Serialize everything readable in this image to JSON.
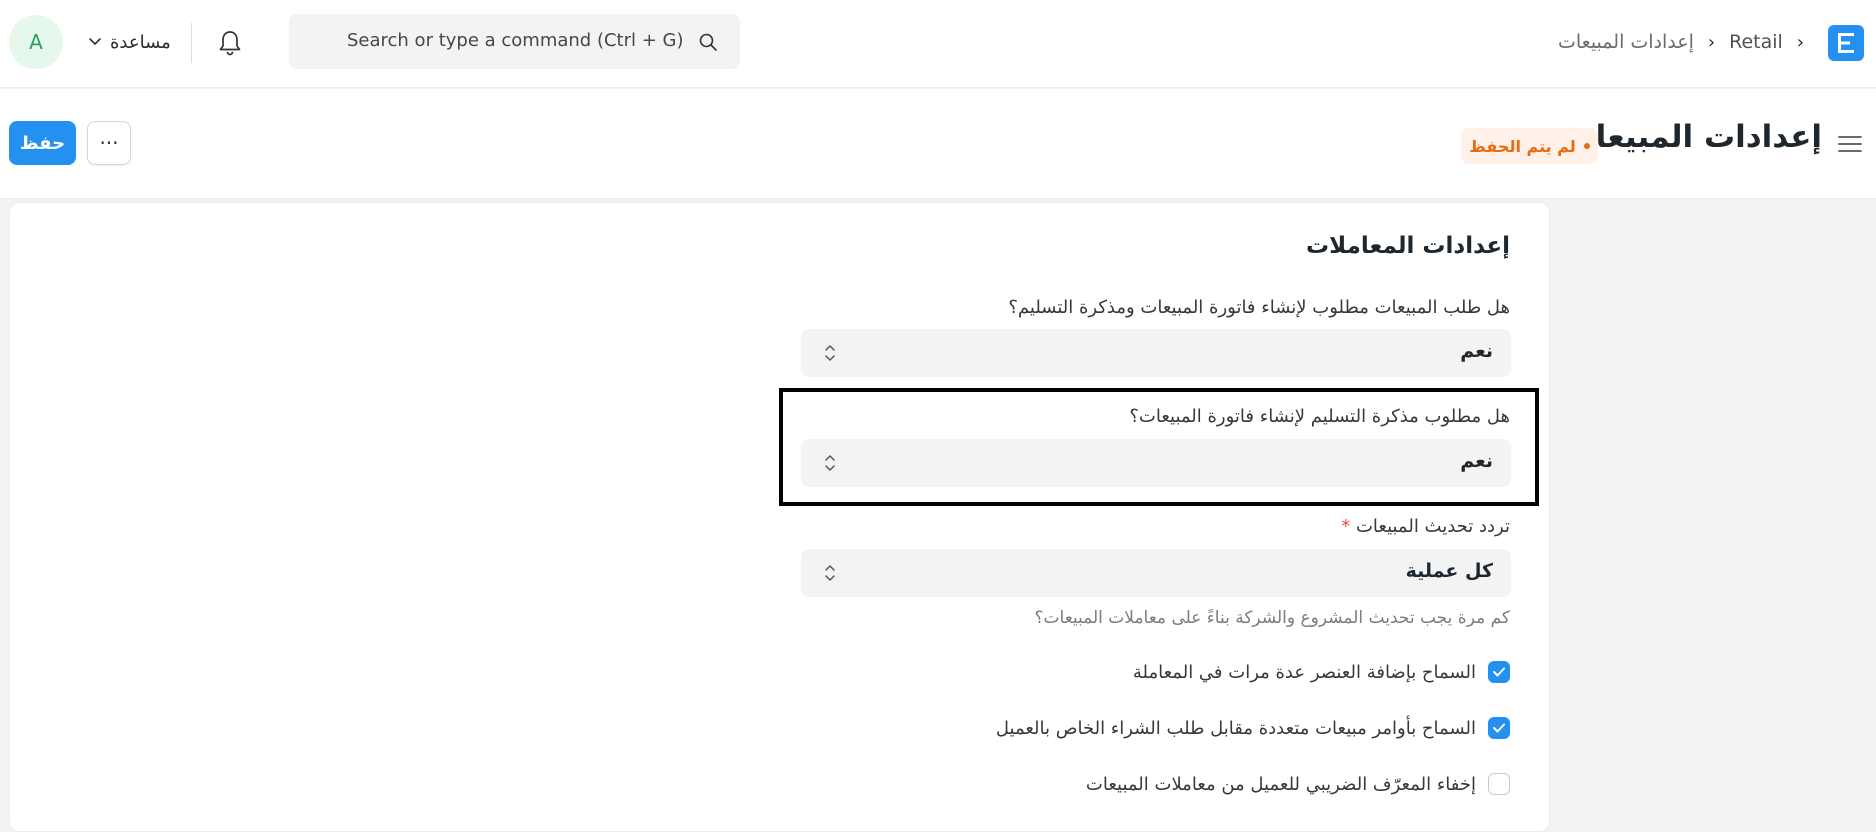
{
  "navbar": {
    "logo_letter": "E",
    "breadcrumbs": [
      "Retail",
      "إعدادات المبيعات"
    ],
    "search_placeholder": "Search or type a command (Ctrl + G)",
    "help_label": "مساعدة",
    "avatar_letter": "A"
  },
  "page": {
    "title": "إعدادات المبيعات",
    "status_badge": "لم يتم الحفظ",
    "more_label": "···",
    "save_label": "حفظ"
  },
  "section": {
    "title": "إعدادات المعاملات",
    "fields": [
      {
        "label": "هل طلب المبيعات مطلوب لإنشاء فاتورة المبيعات ومذكرة التسليم؟",
        "value": "نعم"
      },
      {
        "label": "هل مطلوب مذكرة التسليم لإنشاء فاتورة المبيعات؟",
        "value": "نعم"
      },
      {
        "label": "تردد تحديث المبيعات",
        "required_mark": "*",
        "value": "كل عملية",
        "description": "كم مرة يجب تحديث المشروع والشركة بناءً على معاملات المبيعات؟"
      }
    ],
    "checkboxes": [
      {
        "label": "السماح بإضافة العنصر عدة مرات في المعاملة",
        "checked": true
      },
      {
        "label": "السماح بأوامر مبيعات متعددة مقابل طلب الشراء الخاص بالعميل",
        "checked": true
      },
      {
        "label": "إخفاء المعرّف الضريبي للعميل من معاملات المبيعات",
        "checked": false
      }
    ]
  },
  "colors": {
    "primary": "#2490ef",
    "warning_text": "#e86c13",
    "warning_bg": "#fff1e7"
  }
}
